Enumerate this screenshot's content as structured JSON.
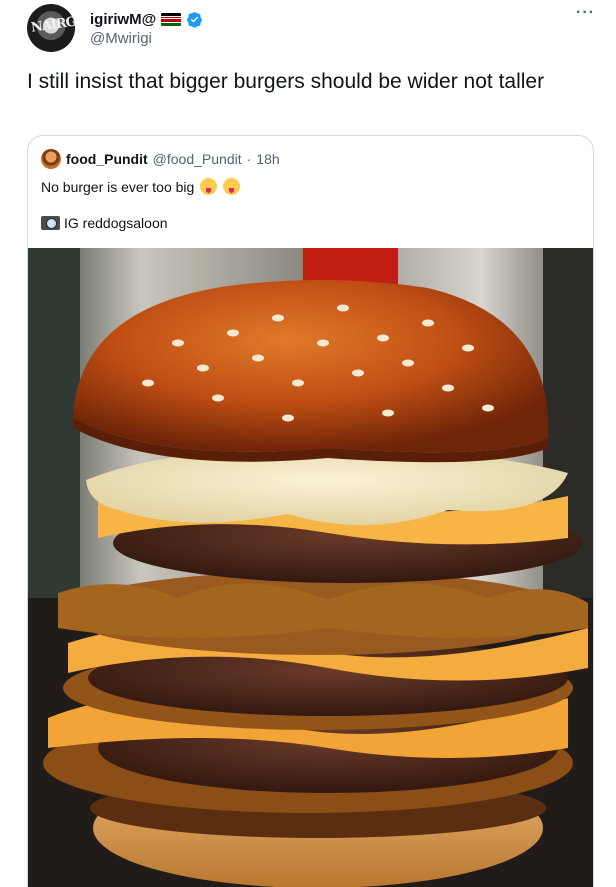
{
  "tweet": {
    "display_name": "igiriwM@",
    "handle": "@Mwirigi",
    "avatar_text": "NAIRG",
    "text": "I still insist that bigger burgers should be wider not taller",
    "more": "···"
  },
  "quote": {
    "display_name": "food_Pundit",
    "handle": "@food_Pundit",
    "dot": "·",
    "time": "18h",
    "line1": "No burger is ever too big",
    "line2": "IG reddogsaloon"
  },
  "colors": {
    "verified": "#1d9bf0",
    "flag": [
      "#000000",
      "#bb0000",
      "#006600",
      "#ffffff"
    ]
  },
  "icons": {
    "verified": "verified-badge-icon",
    "flag": "kenya-flag-icon",
    "more": "more-options-icon",
    "camera": "camera-icon"
  }
}
